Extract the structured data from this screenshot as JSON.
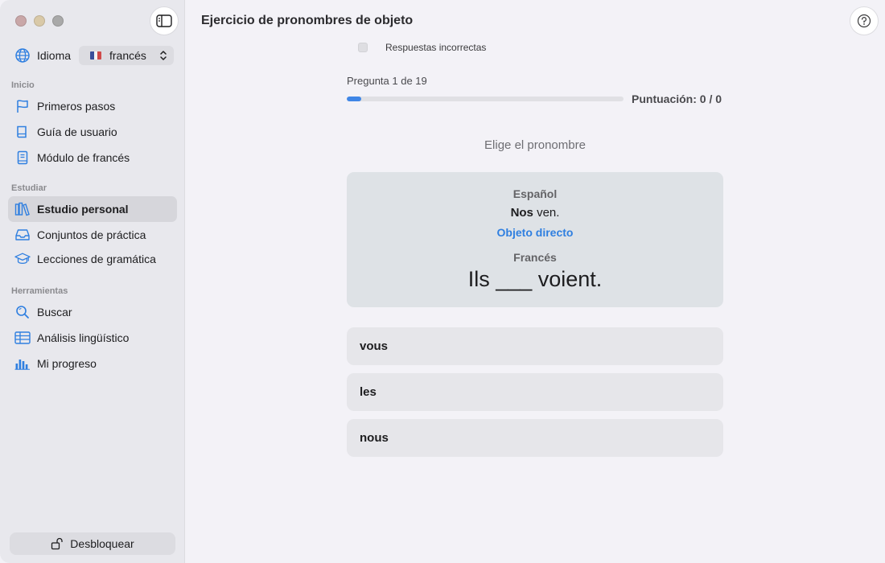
{
  "window": {
    "title": "Ejercicio de pronombres de objeto"
  },
  "sidebar": {
    "language_label": "Idioma",
    "language_value": "francés",
    "sections": [
      {
        "title": "Inicio"
      },
      {
        "title": "Estudiar"
      },
      {
        "title": "Herramientas"
      }
    ],
    "items": [
      {
        "label": "Primeros pasos",
        "icon": "flag-icon"
      },
      {
        "label": "Guía de usuario",
        "icon": "book-icon"
      },
      {
        "label": "Módulo de francés",
        "icon": "notebook-icon"
      },
      {
        "label": "Estudio personal",
        "icon": "books-icon",
        "active": true
      },
      {
        "label": "Conjuntos de práctica",
        "icon": "tray-icon"
      },
      {
        "label": "Lecciones de gramática",
        "icon": "graduation-cap-icon"
      },
      {
        "label": "Buscar",
        "icon": "search-icon"
      },
      {
        "label": "Análisis lingüístico",
        "icon": "table-icon"
      },
      {
        "label": "Mi progreso",
        "icon": "bar-chart-icon"
      }
    ],
    "unlock_label": "Desbloquear"
  },
  "quiz": {
    "filter_label": "Respuestas incorrectas",
    "progress_text": "Pregunta 1 de 19",
    "progress_fraction": 0.0526,
    "score_text": "Puntuación: 0 / 0",
    "instruction": "Elige el pronombre",
    "card": {
      "source_language": "Español",
      "source_bold": "Nos",
      "source_rest": " ven.",
      "object_type": "Objeto directo",
      "target_language": "Francés",
      "target_sentence": "Ils ___ voient."
    },
    "options": [
      "vous",
      "les",
      "nous"
    ]
  },
  "colors": {
    "accent": "#3f86e6",
    "link_blue": "#2f7fe0",
    "sidebar_bg": "#e8e8ed",
    "main_bg": "#f3f2f7"
  }
}
